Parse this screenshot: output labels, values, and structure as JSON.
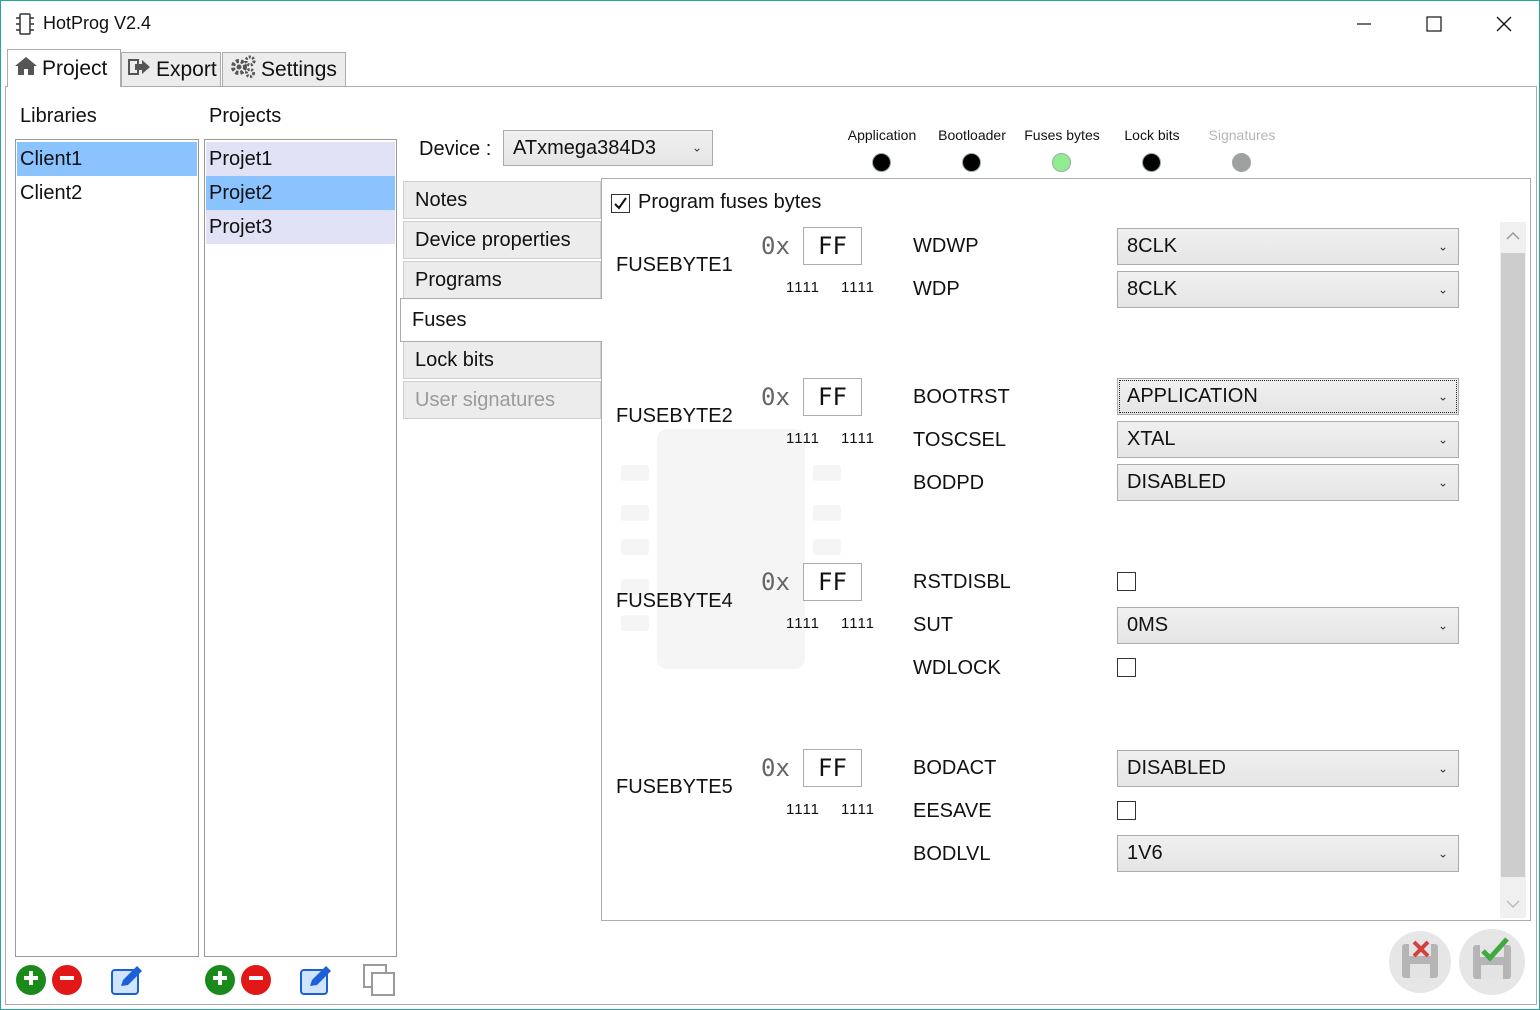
{
  "window": {
    "title": "HotProg V2.4"
  },
  "tabs": [
    {
      "label": "Project",
      "icon": "home-icon"
    },
    {
      "label": "Export",
      "icon": "export-icon"
    },
    {
      "label": "Settings",
      "icon": "gear-icon"
    }
  ],
  "libraries": {
    "header": "Libraries",
    "items": [
      "Client1",
      "Client2"
    ],
    "selected": "Client1"
  },
  "projects": {
    "header": "Projects",
    "items": [
      "Projet1",
      "Projet2",
      "Projet3"
    ],
    "selected": "Projet2"
  },
  "device": {
    "label": "Device :",
    "value": "ATxmega384D3"
  },
  "status": [
    {
      "label": "Application",
      "color": "#000000"
    },
    {
      "label": "Bootloader",
      "color": "#000000"
    },
    {
      "label": "Fuses bytes",
      "color": "#90ee90"
    },
    {
      "label": "Lock bits",
      "color": "#000000"
    },
    {
      "label": "Signatures",
      "color": "#a0a0a0"
    }
  ],
  "side_tabs": [
    "Notes",
    "Device properties",
    "Programs",
    "Fuses",
    "Lock bits",
    "User signatures"
  ],
  "active_side_tab": "Fuses",
  "fuses": {
    "program_label": "Program fuses bytes",
    "program_checked": true,
    "prefix": "0x",
    "bytes": [
      {
        "name": "FUSEBYTE1",
        "hex": "FF",
        "bits_hi": "1111",
        "bits_lo": "1111",
        "fields": [
          {
            "label": "WDWP",
            "value": "8CLK"
          },
          {
            "label": "WDP",
            "value": "8CLK"
          }
        ]
      },
      {
        "name": "FUSEBYTE2",
        "hex": "FF",
        "bits_hi": "1111",
        "bits_lo": "1111",
        "fields": [
          {
            "label": "BOOTRST",
            "value": "APPLICATION"
          },
          {
            "label": "TOSCSEL",
            "value": "XTAL"
          },
          {
            "label": "BODPD",
            "value": "DISABLED"
          }
        ]
      },
      {
        "name": "FUSEBYTE4",
        "hex": "FF",
        "bits_hi": "1111",
        "bits_lo": "1111",
        "fields": [
          {
            "label": "RSTDISBL",
            "value": ""
          },
          {
            "label": "SUT",
            "value": "0MS"
          },
          {
            "label": "WDLOCK",
            "value": ""
          }
        ]
      },
      {
        "name": "FUSEBYTE5",
        "hex": "FF",
        "bits_hi": "1111",
        "bits_lo": "1111",
        "fields": [
          {
            "label": "BODACT",
            "value": "DISABLED"
          },
          {
            "label": "EESAVE",
            "value": ""
          },
          {
            "label": "BODLVL",
            "value": "1V6"
          }
        ]
      }
    ]
  }
}
